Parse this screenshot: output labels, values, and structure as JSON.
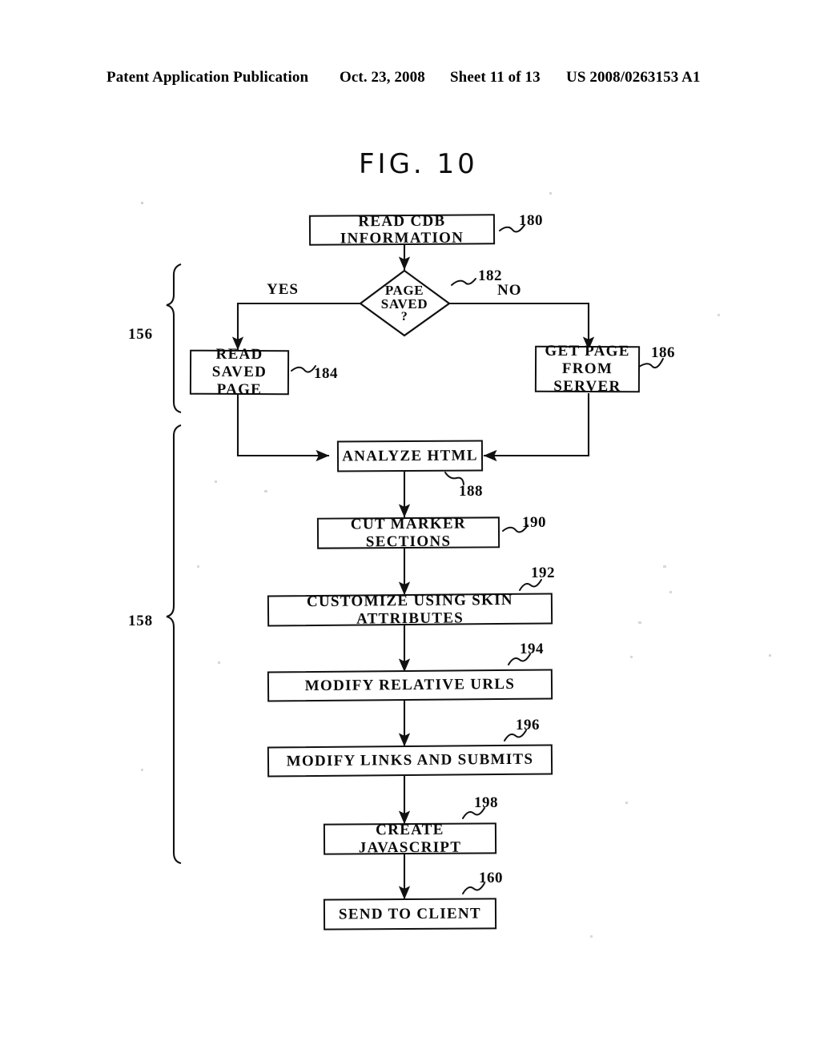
{
  "header": {
    "publication": "Patent Application Publication",
    "date": "Oct. 23, 2008",
    "sheet": "Sheet 11 of 13",
    "patent_number": "US 2008/0263153 A1"
  },
  "figure": {
    "title": "FIG. 10"
  },
  "flowchart": {
    "type": "flowchart",
    "nodes": [
      {
        "id": "read_cdb",
        "label": "READ CDB INFORMATION",
        "ref": "180",
        "shape": "process"
      },
      {
        "id": "page_saved",
        "label": "PAGE SAVED ?",
        "ref": "182",
        "shape": "decision"
      },
      {
        "id": "read_saved",
        "label": "READ SAVED PAGE",
        "ref": "184",
        "shape": "process"
      },
      {
        "id": "get_page",
        "label": "GET PAGE FROM SERVER",
        "ref": "186",
        "shape": "process"
      },
      {
        "id": "analyze_html",
        "label": "ANALYZE HTML",
        "ref": "188",
        "shape": "process"
      },
      {
        "id": "cut_marker",
        "label": "CUT MARKER SECTIONS",
        "ref": "190",
        "shape": "process"
      },
      {
        "id": "customize",
        "label": "CUSTOMIZE USING SKIN ATTRIBUTES",
        "ref": "192",
        "shape": "process"
      },
      {
        "id": "modify_urls",
        "label": "MODIFY RELATIVE URLS",
        "ref": "194",
        "shape": "process"
      },
      {
        "id": "modify_links",
        "label": "MODIFY LINKS AND SUBMITS",
        "ref": "196",
        "shape": "process"
      },
      {
        "id": "create_js",
        "label": "CREATE JAVASCRIPT",
        "ref": "198",
        "shape": "process"
      },
      {
        "id": "send_client",
        "label": "SEND TO CLIENT",
        "ref": "160",
        "shape": "process"
      }
    ],
    "node_labels": {
      "read_cdb": "READ CDB INFORMATION",
      "page_saved_line1": "PAGE",
      "page_saved_line2": "SAVED",
      "page_saved_line3": "?",
      "read_saved_line1": "READ SAVED",
      "read_saved_line2": "PAGE",
      "get_page_line1": "GET PAGE",
      "get_page_line2": "FROM SERVER",
      "analyze_html": "ANALYZE HTML",
      "cut_marker": "CUT MARKER SECTIONS",
      "customize": "CUSTOMIZE USING SKIN ATTRIBUTES",
      "modify_urls": "MODIFY RELATIVE URLS",
      "modify_links": "MODIFY LINKS AND SUBMITS",
      "create_js": "CREATE JAVASCRIPT",
      "send_client": "SEND TO CLIENT"
    },
    "refs": {
      "read_cdb": "180",
      "page_saved": "182",
      "read_saved": "184",
      "get_page": "186",
      "analyze_html": "188",
      "cut_marker": "190",
      "customize": "192",
      "modify_urls": "194",
      "modify_links": "196",
      "create_js": "198",
      "send_client": "160"
    },
    "branch_labels": {
      "yes": "YES",
      "no": "NO"
    },
    "groups": [
      {
        "id": "group_156",
        "label": "156",
        "covers": [
          "page_saved",
          "read_saved",
          "get_page"
        ]
      },
      {
        "id": "group_158",
        "label": "158",
        "covers": [
          "analyze_html",
          "cut_marker",
          "customize",
          "modify_urls",
          "modify_links",
          "create_js"
        ]
      }
    ],
    "group_labels": {
      "upper": "156",
      "lower": "158"
    },
    "edges": [
      {
        "from": "read_cdb",
        "to": "page_saved",
        "label": ""
      },
      {
        "from": "page_saved",
        "to": "read_saved",
        "label": "YES"
      },
      {
        "from": "page_saved",
        "to": "get_page",
        "label": "NO"
      },
      {
        "from": "read_saved",
        "to": "analyze_html",
        "label": ""
      },
      {
        "from": "get_page",
        "to": "analyze_html",
        "label": ""
      },
      {
        "from": "analyze_html",
        "to": "cut_marker",
        "label": ""
      },
      {
        "from": "cut_marker",
        "to": "customize",
        "label": ""
      },
      {
        "from": "customize",
        "to": "modify_urls",
        "label": ""
      },
      {
        "from": "modify_urls",
        "to": "modify_links",
        "label": ""
      },
      {
        "from": "modify_links",
        "to": "create_js",
        "label": ""
      },
      {
        "from": "create_js",
        "to": "send_client",
        "label": ""
      }
    ]
  },
  "colors": {
    "ink": "#0a0a0a",
    "paper": "#ffffff"
  }
}
